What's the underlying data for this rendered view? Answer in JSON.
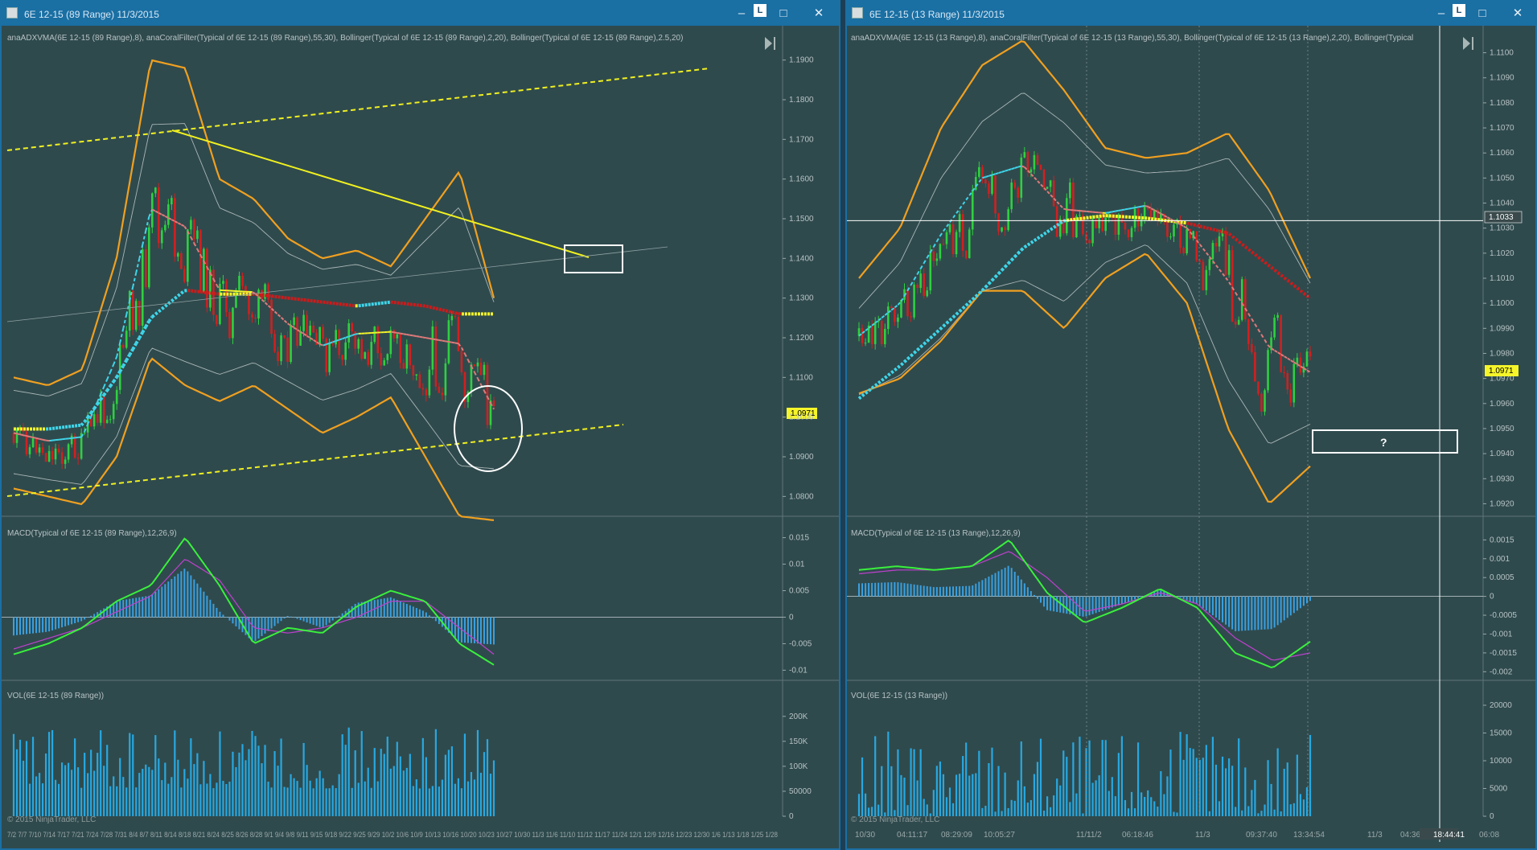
{
  "left": {
    "title": "6E 12-15 (89 Range)  11/3/2015",
    "lock": "L",
    "indicator_label": "anaADXVMA(6E 12-15 (89 Range),8), anaCoralFilter(Typical of 6E 12-15 (89 Range),55,30), Bollinger(Typical of 6E 12-15 (89 Range),2,20), Bollinger(Typical of 6E 12-15 (89 Range),2.5,20)",
    "price_ticks": [
      "1.1900",
      "1.1800",
      "1.1700",
      "1.1600",
      "1.1500",
      "1.1400",
      "1.1300",
      "1.1200",
      "1.1100",
      "1.1000",
      "1.0900",
      "1.0800"
    ],
    "last_price": "1.0971",
    "macd_label": "MACD(Typical of 6E 12-15 (89 Range),12,26,9)",
    "macd_ticks": [
      "0.015",
      "0.01",
      "0.005",
      "0",
      "-0.005",
      "-0.01"
    ],
    "vol_label": "VOL(6E 12-15 (89 Range))",
    "vol_ticks": [
      "200K",
      "150K",
      "100K",
      "50000",
      "0"
    ],
    "copyright": "© 2015 NinjaTrader, LLC",
    "time_axis": "7/2 7/7 7/10 7/14 7/17 7/21 7/24 7/28 7/31 8/4 8/7 8/11 8/14 8/18 8/21 8/24 8/25 8/26 8/28 9/1 9/4 9/8 9/11 9/15 9/18 9/22 9/25 9/29 10/2 10/6 10/9 10/13 10/16 10/20 10/23 10/27 10/30 11/3 11/6 11/10 11/12 11/17 11/24 12/1 12/9 12/16 12/23 12/30 1/6 1/13 1/18 1/25 1/28"
  },
  "right": {
    "title": "6E 12-15 (13 Range)  11/3/2015",
    "lock": "L",
    "indicator_label": "anaADXVMA(6E 12-15 (13 Range),8), anaCoralFilter(Typical of 6E 12-15 (13 Range),55,30), Bollinger(Typical of 6E 12-15 (13 Range),2,20), Bollinger(Typical",
    "price_ticks": [
      "1.1100",
      "1.1090",
      "1.1080",
      "1.1070",
      "1.1060",
      "1.1050",
      "1.1040",
      "1.1030",
      "1.1020",
      "1.1010",
      "1.1000",
      "1.0990",
      "1.0980",
      "1.0970",
      "1.0960",
      "1.0950",
      "1.0940",
      "1.0930",
      "1.0920"
    ],
    "crosshair_price": "1.1033",
    "last_price": "1.0971",
    "question_box": "?",
    "macd_label": "MACD(Typical of 6E 12-15 (13 Range),12,26,9)",
    "macd_ticks": [
      "0.0015",
      "0.001",
      "0.0005",
      "0",
      "-0.0005",
      "-0.001",
      "-0.0015",
      "-0.002"
    ],
    "vol_label": "VOL(6E 12-15 (13 Range))",
    "vol_ticks": [
      "20000",
      "15000",
      "10000",
      "5000",
      "0"
    ],
    "copyright": "© 2015 NinjaTrader, LLC",
    "time_labels": [
      "10/30",
      "04:11:17",
      "08:29:09",
      "10:05:27",
      "11/1",
      "11/2",
      "06:18:46",
      "11/3",
      "09:37:40",
      "13:34:54",
      "11/3",
      "04:36",
      "18:44:41",
      "06:08"
    ]
  },
  "colors": {
    "background": "#2f4a4d",
    "titlebar": "#1a6fa3",
    "bollinger_outer": "#f0a020",
    "bollinger_inner": "#a9b6b6",
    "coral_up": "#3fd6ea",
    "coral_flat": "#f5f52a",
    "coral_down": "#cc1b1b",
    "macd_line": "#39f03c",
    "signal_line": "#c040d0",
    "histogram": "#3aa0e0",
    "volume": "#28a8e0",
    "trendline": "#f0f020"
  },
  "chart_data": [
    {
      "type": "line",
      "panel": "6E 12-15 (89 Range) price",
      "ylim": [
        1.075,
        1.195
      ],
      "last_price": 1.0971,
      "bollinger_upper": [
        1.11,
        1.108,
        1.112,
        1.14,
        1.19,
        1.188,
        1.16,
        1.155,
        1.145,
        1.14,
        1.142,
        1.138,
        1.15,
        1.162,
        1.13
      ],
      "bollinger_lower": [
        1.082,
        1.08,
        1.078,
        1.09,
        1.115,
        1.108,
        1.104,
        1.108,
        1.102,
        1.096,
        1.1,
        1.105,
        1.09,
        1.075,
        1.074
      ],
      "coral_filter": [
        1.097,
        1.097,
        1.098,
        1.11,
        1.125,
        1.132,
        1.131,
        1.131,
        1.13,
        1.129,
        1.128,
        1.129,
        1.128,
        1.126,
        1.126
      ]
    },
    {
      "type": "bar",
      "panel": "6E 12-15 (89 Range) MACD",
      "ylim": [
        -0.011,
        0.016
      ],
      "macd": [
        -0.007,
        -0.005,
        -0.002,
        0.003,
        0.006,
        0.015,
        0.006,
        -0.005,
        -0.002,
        -0.003,
        0.002,
        0.005,
        0.003,
        -0.005,
        -0.009
      ],
      "signal": [
        -0.006,
        -0.004,
        -0.002,
        0.001,
        0.004,
        0.011,
        0.007,
        -0.002,
        -0.003,
        -0.002,
        0.0,
        0.003,
        0.003,
        -0.002,
        -0.007
      ]
    },
    {
      "type": "bar",
      "panel": "6E 12-15 (89 Range) VOL",
      "ylim": [
        0,
        240000
      ],
      "volume_range": [
        60000,
        230000
      ]
    },
    {
      "type": "line",
      "panel": "6E 12-15 (13 Range) price",
      "ylim": [
        1.0915,
        1.1105
      ],
      "crosshair_price": 1.1033,
      "last_price": 1.0971,
      "bollinger_upper": [
        1.101,
        1.103,
        1.107,
        1.1095,
        1.1105,
        1.1085,
        1.1062,
        1.1058,
        1.106,
        1.1068,
        1.1045,
        1.101
      ],
      "bollinger_lower": [
        1.0964,
        1.097,
        1.0985,
        1.1005,
        1.1005,
        1.099,
        1.101,
        1.102,
        1.1,
        1.095,
        1.092,
        1.0935
      ],
      "coral_filter": [
        1.0962,
        1.0975,
        1.099,
        1.1005,
        1.1022,
        1.1033,
        1.1035,
        1.1034,
        1.1032,
        1.1028,
        1.1015,
        1.1002
      ]
    },
    {
      "type": "bar",
      "panel": "6E 12-15 (13 Range) MACD",
      "ylim": [
        -0.0021,
        0.0017
      ],
      "macd": [
        0.0007,
        0.0008,
        0.0007,
        0.0008,
        0.0015,
        0.0001,
        -0.0007,
        -0.0003,
        0.0002,
        -0.0003,
        -0.0015,
        -0.0019,
        -0.0012
      ],
      "signal": [
        0.0006,
        0.0007,
        0.0007,
        0.0008,
        0.0012,
        0.0005,
        -0.0004,
        -0.0002,
        0.0001,
        -0.0002,
        -0.0011,
        -0.0017,
        -0.0015
      ]
    },
    {
      "type": "bar",
      "panel": "6E 12-15 (13 Range) VOL",
      "ylim": [
        0,
        20000
      ],
      "volume_range": [
        500,
        19500
      ]
    }
  ]
}
